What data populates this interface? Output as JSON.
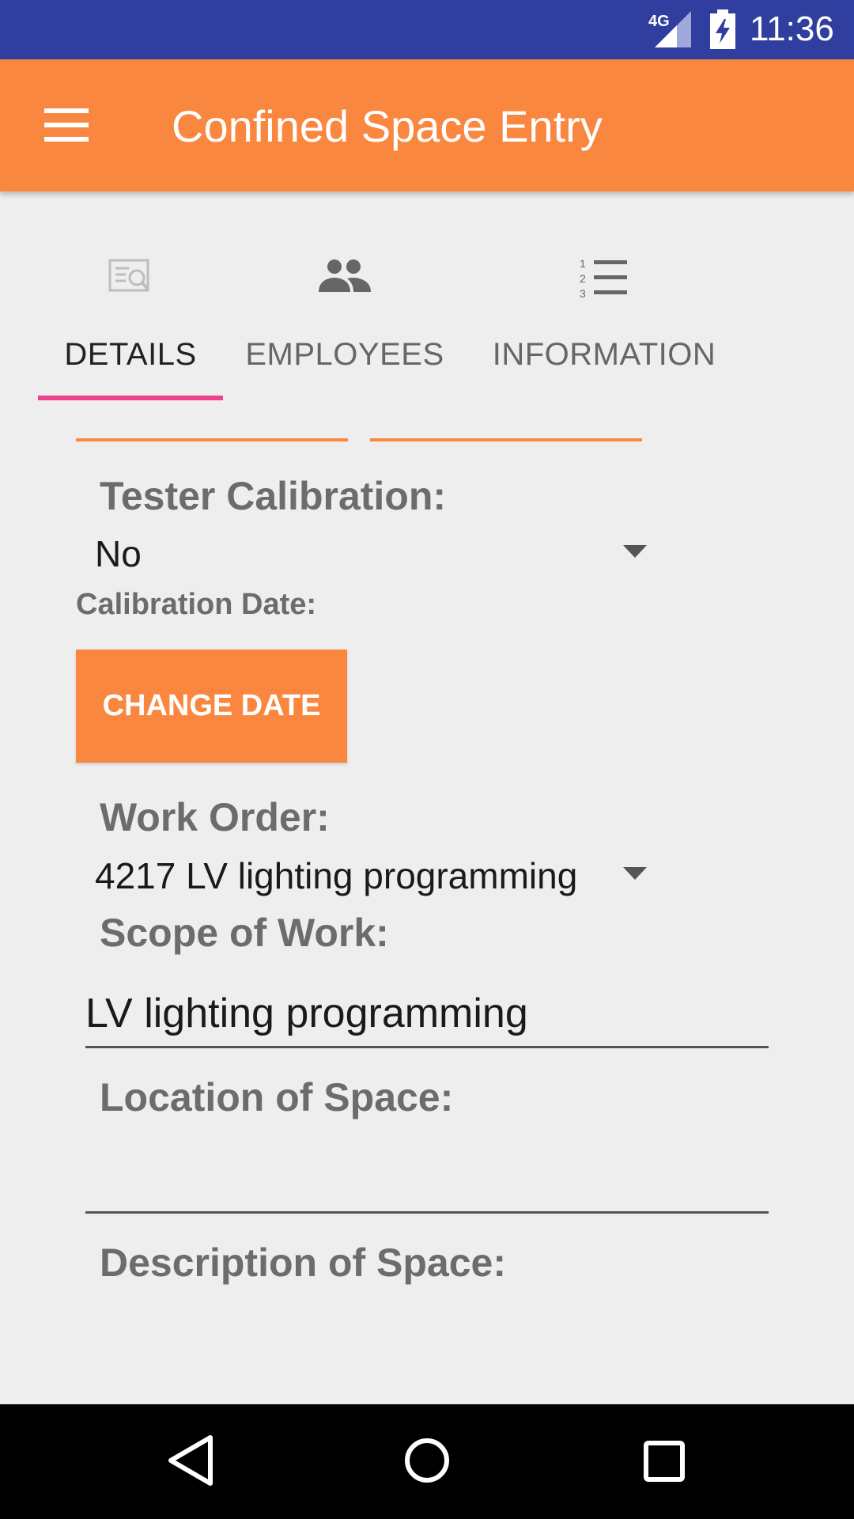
{
  "status_bar": {
    "network": "4G",
    "time": "11:36",
    "icons": [
      "signal-icon",
      "battery-charging-icon"
    ]
  },
  "app_bar": {
    "title": "Confined Space Entry",
    "menu_icon": "hamburger-menu-icon"
  },
  "tabs": [
    {
      "label": "DETAILS",
      "icon": "document-search-icon",
      "active": true
    },
    {
      "label": "EMPLOYEES",
      "icon": "people-icon",
      "active": false
    },
    {
      "label": "INFORMATION",
      "icon": "numbered-list-icon",
      "active": false
    }
  ],
  "form": {
    "tester_calibration": {
      "label": "Tester Calibration:",
      "value": "No"
    },
    "calibration_date": {
      "label": "Calibration Date:",
      "button": "CHANGE DATE"
    },
    "work_order": {
      "label": "Work Order:",
      "value": "4217 LV lighting programming"
    },
    "scope_of_work": {
      "label": "Scope of Work:",
      "value": "LV lighting programming"
    },
    "location_of_space": {
      "label": "Location of Space:",
      "value": ""
    },
    "description_of_space": {
      "label": "Description of Space:"
    }
  },
  "colors": {
    "status_bar": "#303f9f",
    "app_bar": "#fa873f",
    "tab_indicator": "#f0418f",
    "background": "#eeeeee"
  },
  "nav_bar": {
    "buttons": [
      "back-icon",
      "home-icon",
      "recents-icon"
    ]
  }
}
